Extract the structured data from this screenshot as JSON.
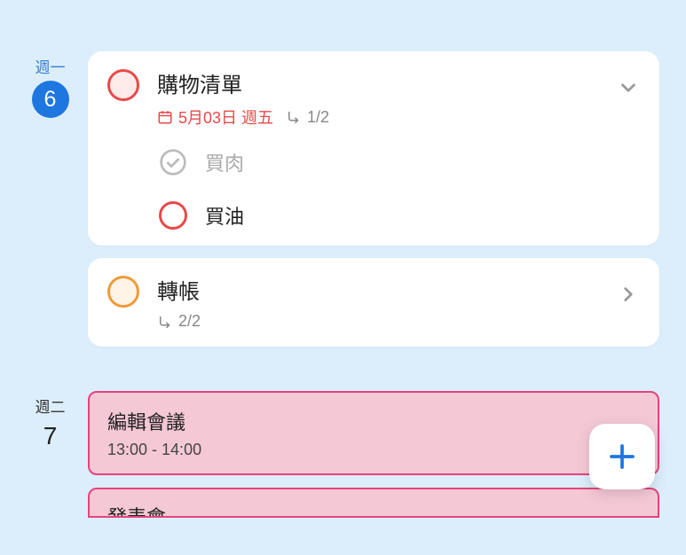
{
  "days": [
    {
      "label": "週一",
      "number": "6",
      "isToday": true,
      "tasks": [
        {
          "title": "購物清單",
          "date": "5月03日 週五",
          "progress": "1/2",
          "color": "red",
          "expanded": true,
          "subtasks": [
            {
              "label": "買肉",
              "done": true
            },
            {
              "label": "買油",
              "done": false
            }
          ]
        },
        {
          "title": "轉帳",
          "progress": "2/2",
          "color": "orange",
          "expanded": false
        }
      ]
    },
    {
      "label": "週二",
      "number": "7",
      "isToday": false,
      "events": [
        {
          "title": "編輯會議",
          "time": "13:00 - 14:00"
        },
        {
          "title": "發表會",
          "partial": true
        }
      ]
    }
  ],
  "ui": {
    "addIcon": "plus-icon"
  }
}
